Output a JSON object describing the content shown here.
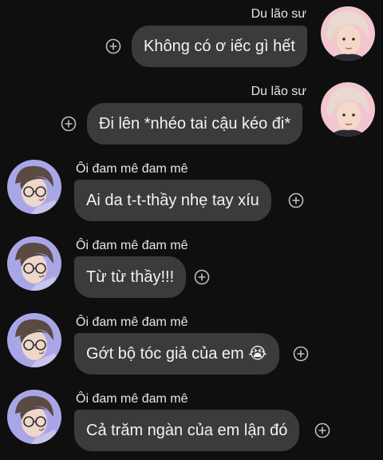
{
  "messages": [
    {
      "sender": "Du lão sư",
      "text": "Không có ơ iếc gì hết",
      "emoji": "",
      "avatar_icon": "avatar-pink-hair-icon"
    },
    {
      "sender": "Du lão sư",
      "text": "Đi lên *nhéo tai cậu kéo đi*",
      "emoji": "",
      "avatar_icon": "avatar-pink-hair-icon"
    },
    {
      "sender": "Ôi đam mê đam mê",
      "text": "Ai da t-t-thầy nhẹ tay xíu",
      "emoji": "",
      "avatar_icon": "avatar-glasses-icon"
    },
    {
      "sender": "Ôi đam mê đam mê",
      "text": "Từ từ thầy!!!",
      "emoji": "",
      "avatar_icon": "avatar-glasses-icon"
    },
    {
      "sender": "Ôi đam mê đam mê",
      "text": "Gớt bộ tóc giả của em",
      "emoji": "😭",
      "avatar_icon": "avatar-glasses-icon"
    },
    {
      "sender": "Ôi đam mê đam mê",
      "text": "Cả trăm ngàn của em lận đó",
      "emoji": "",
      "avatar_icon": "avatar-glasses-icon"
    }
  ],
  "colors": {
    "background": "#0f0f10",
    "bubble": "#3b3b3d",
    "text": "#f2f2f2",
    "add_icon": "#bdbdbd"
  }
}
